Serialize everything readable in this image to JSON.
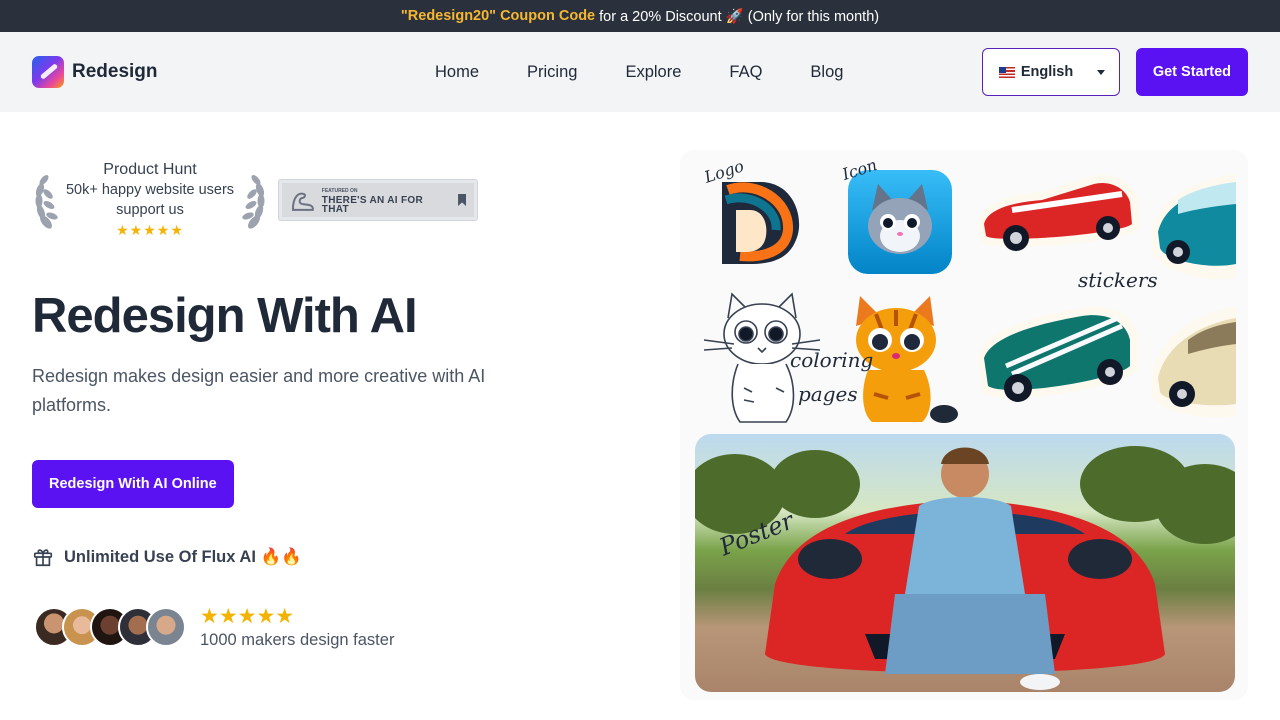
{
  "promo": {
    "code": "\"Redesign20\" Coupon Code",
    "text": "for a 20% Discount 🚀 (Only for this month)"
  },
  "header": {
    "brand": "Redesign",
    "nav": [
      "Home",
      "Pricing",
      "Explore",
      "FAQ",
      "Blog"
    ],
    "language": "English",
    "cta": "Get Started"
  },
  "hero": {
    "badge": {
      "title": "Product Hunt",
      "line1": "50k+ happy website users",
      "line2": "support us",
      "stars": "★★★★★"
    },
    "featured": {
      "small": "FEATURED ON",
      "big": "THERE'S AN AI FOR THAT"
    },
    "title": "Redesign With AI",
    "description": "Redesign makes design easier and more creative with AI platforms.",
    "primary_button": "Redesign With AI Online",
    "flux": "Unlimited Use Of Flux AI 🔥🔥",
    "rating_stars": "★★★★★",
    "makers": "1000 makers design faster"
  },
  "gallery": {
    "labels": {
      "logo": "Logo",
      "icon": "Icon",
      "stickers": "stickers",
      "coloring1": "coloring",
      "coloring2": "pages",
      "poster": "Poster"
    }
  },
  "colors": {
    "accent": "#5b12f2",
    "promo_bg": "#2b313c",
    "coupon": "#f5b830",
    "star": "#f5b301"
  }
}
